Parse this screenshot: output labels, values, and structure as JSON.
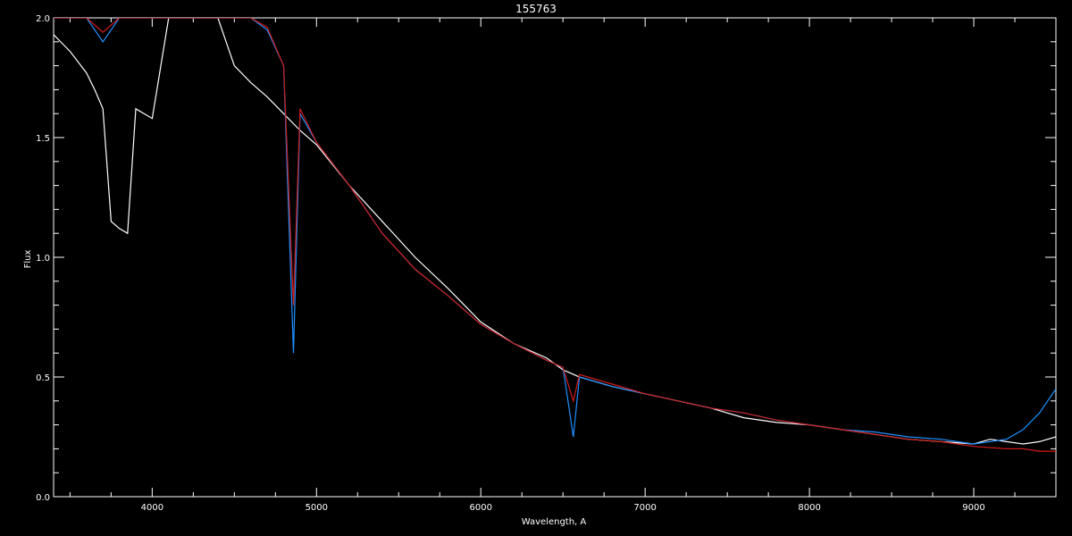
{
  "chart_data": {
    "type": "line",
    "title": "155763",
    "xlabel": "Wavelength, A",
    "ylabel": "Flux",
    "xlim": [
      3400,
      9500
    ],
    "ylim": [
      0.0,
      2.0
    ],
    "xticks": [
      4000,
      5000,
      6000,
      7000,
      8000,
      9000
    ],
    "xtick_labels": [
      "4000",
      "5000",
      "6000",
      "7000",
      "8000",
      "9000"
    ],
    "yticks": [
      0.0,
      0.5,
      1.0,
      1.5,
      2.0
    ],
    "ytick_labels": [
      "0.0",
      "0.5",
      "1.0",
      "1.5",
      "2.0"
    ],
    "grid": false,
    "background": "#000000",
    "series": [
      {
        "color": "#ffffff",
        "values": [
          [
            3400,
            1.93
          ],
          [
            3500,
            1.86
          ],
          [
            3600,
            1.77
          ],
          [
            3650,
            1.7
          ],
          [
            3700,
            1.62
          ],
          [
            3750,
            1.15
          ],
          [
            3800,
            1.12
          ],
          [
            3850,
            1.1
          ],
          [
            3900,
            1.62
          ],
          [
            4000,
            1.58
          ],
          [
            4100,
            2.0
          ],
          [
            4200,
            2.0
          ],
          [
            4300,
            2.0
          ],
          [
            4400,
            2.0
          ],
          [
            4500,
            1.8
          ],
          [
            4600,
            1.73
          ],
          [
            4700,
            1.67
          ],
          [
            4800,
            1.6
          ],
          [
            4900,
            1.53
          ],
          [
            5000,
            1.47
          ],
          [
            5200,
            1.3
          ],
          [
            5400,
            1.15
          ],
          [
            5600,
            1.0
          ],
          [
            5800,
            0.87
          ],
          [
            6000,
            0.73
          ],
          [
            6200,
            0.64
          ],
          [
            6400,
            0.58
          ],
          [
            6500,
            0.53
          ],
          [
            6600,
            0.5
          ],
          [
            6800,
            0.46
          ],
          [
            7000,
            0.43
          ],
          [
            7200,
            0.4
          ],
          [
            7400,
            0.37
          ],
          [
            7600,
            0.33
          ],
          [
            7800,
            0.31
          ],
          [
            8000,
            0.3
          ],
          [
            8200,
            0.28
          ],
          [
            8400,
            0.26
          ],
          [
            8600,
            0.24
          ],
          [
            8800,
            0.23
          ],
          [
            9000,
            0.22
          ],
          [
            9100,
            0.24
          ],
          [
            9200,
            0.23
          ],
          [
            9300,
            0.22
          ],
          [
            9400,
            0.23
          ],
          [
            9500,
            0.25
          ]
        ]
      },
      {
        "color": "#1e90ff",
        "values": [
          [
            3400,
            2.0
          ],
          [
            3500,
            2.0
          ],
          [
            3600,
            2.0
          ],
          [
            3700,
            1.9
          ],
          [
            3800,
            2.0
          ],
          [
            3900,
            2.0
          ],
          [
            4000,
            2.0
          ],
          [
            4100,
            2.0
          ],
          [
            4200,
            2.0
          ],
          [
            4300,
            2.0
          ],
          [
            4400,
            2.0
          ],
          [
            4500,
            2.0
          ],
          [
            4600,
            2.0
          ],
          [
            4700,
            1.95
          ],
          [
            4800,
            1.8
          ],
          [
            4860,
            0.6
          ],
          [
            4900,
            1.6
          ],
          [
            5000,
            1.48
          ],
          [
            5200,
            1.3
          ],
          [
            5400,
            1.1
          ],
          [
            5600,
            0.95
          ],
          [
            5800,
            0.84
          ],
          [
            6000,
            0.72
          ],
          [
            6200,
            0.64
          ],
          [
            6400,
            0.57
          ],
          [
            6500,
            0.54
          ],
          [
            6563,
            0.25
          ],
          [
            6600,
            0.5
          ],
          [
            6800,
            0.46
          ],
          [
            7000,
            0.43
          ],
          [
            7200,
            0.4
          ],
          [
            7400,
            0.37
          ],
          [
            7600,
            0.35
          ],
          [
            7800,
            0.32
          ],
          [
            8000,
            0.3
          ],
          [
            8200,
            0.28
          ],
          [
            8400,
            0.27
          ],
          [
            8600,
            0.25
          ],
          [
            8800,
            0.24
          ],
          [
            9000,
            0.22
          ],
          [
            9200,
            0.24
          ],
          [
            9300,
            0.28
          ],
          [
            9400,
            0.35
          ],
          [
            9500,
            0.45
          ]
        ]
      },
      {
        "color": "#d01c1c",
        "values": [
          [
            3400,
            2.0
          ],
          [
            3600,
            2.0
          ],
          [
            3700,
            1.94
          ],
          [
            3800,
            2.0
          ],
          [
            4000,
            2.0
          ],
          [
            4200,
            2.0
          ],
          [
            4400,
            2.0
          ],
          [
            4600,
            2.0
          ],
          [
            4700,
            1.96
          ],
          [
            4800,
            1.8
          ],
          [
            4860,
            0.8
          ],
          [
            4900,
            1.62
          ],
          [
            5000,
            1.48
          ],
          [
            5200,
            1.3
          ],
          [
            5400,
            1.1
          ],
          [
            5600,
            0.95
          ],
          [
            5800,
            0.84
          ],
          [
            6000,
            0.72
          ],
          [
            6200,
            0.64
          ],
          [
            6400,
            0.57
          ],
          [
            6500,
            0.54
          ],
          [
            6563,
            0.4
          ],
          [
            6600,
            0.51
          ],
          [
            6800,
            0.47
          ],
          [
            7000,
            0.43
          ],
          [
            7200,
            0.4
          ],
          [
            7400,
            0.37
          ],
          [
            7600,
            0.35
          ],
          [
            7800,
            0.32
          ],
          [
            8000,
            0.3
          ],
          [
            8200,
            0.28
          ],
          [
            8400,
            0.26
          ],
          [
            8600,
            0.24
          ],
          [
            8800,
            0.23
          ],
          [
            9000,
            0.21
          ],
          [
            9200,
            0.2
          ],
          [
            9300,
            0.2
          ],
          [
            9400,
            0.19
          ],
          [
            9500,
            0.19
          ]
        ]
      }
    ]
  }
}
